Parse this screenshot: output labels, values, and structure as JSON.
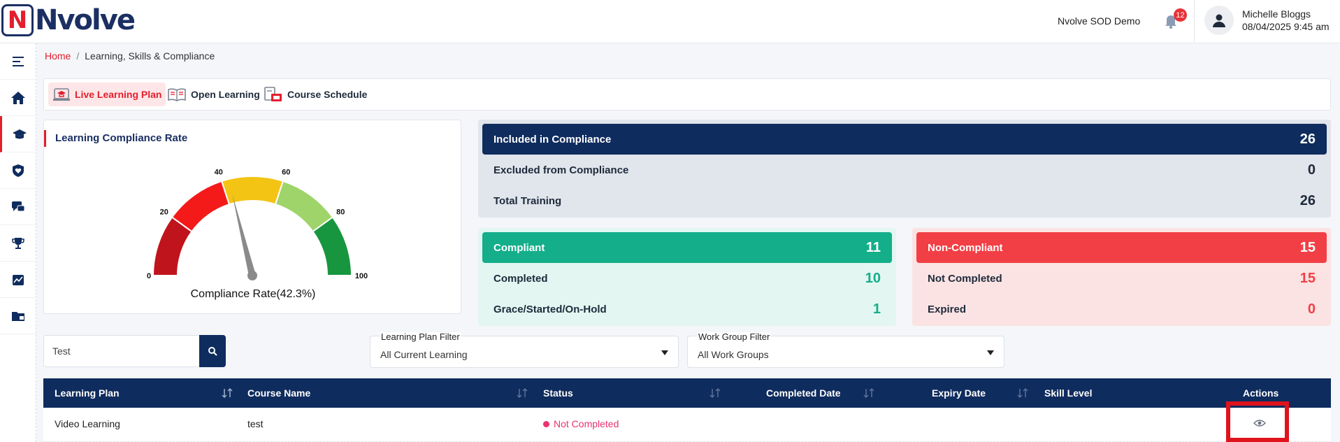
{
  "header": {
    "logo_letter": "N",
    "logo_text": "Nvolve",
    "org_name": "Nvolve SOD Demo",
    "notification_count": "12",
    "user_name": "Michelle Bloggs",
    "user_datetime": "08/04/2025 9:45 am"
  },
  "sidebar": {
    "items": [
      "menu-toggle-icon",
      "home-icon",
      "graduation-cap-icon",
      "shield-heart-icon",
      "chat-icon",
      "trophy-icon",
      "chart-icon",
      "folder-icon"
    ],
    "active_index": 2
  },
  "breadcrumb": {
    "home": "Home",
    "separator": "/",
    "current": "Learning, Skills & Compliance"
  },
  "tabs": [
    {
      "label": "Live Learning Plan",
      "active": true,
      "icon": "laptop-cap-icon"
    },
    {
      "label": "Open Learning",
      "active": false,
      "icon": "open-book-icon"
    },
    {
      "label": "Course Schedule",
      "active": false,
      "icon": "calendar-board-icon"
    }
  ],
  "gauge": {
    "title": "Learning Compliance Rate",
    "caption_label": "Compliance Rate",
    "caption_value": "(42.3%)",
    "value": 42.3,
    "min": 0,
    "max": 100,
    "ticks": [
      "0",
      "20",
      "40",
      "60",
      "80",
      "100"
    ],
    "band_colors": [
      "#c0141d",
      "#f41a1a",
      "#f3c414",
      "#9fd46a",
      "#17963f"
    ]
  },
  "summary": {
    "included_label": "Included in Compliance",
    "included_value": "26",
    "excluded_label": "Excluded from Compliance",
    "excluded_value": "0",
    "total_label": "Total Training",
    "total_value": "26"
  },
  "compliant": {
    "label": "Compliant",
    "value": "11",
    "completed_label": "Completed",
    "completed_value": "10",
    "grace_label": "Grace/Started/On-Hold",
    "grace_value": "1"
  },
  "non_compliant": {
    "label": "Non-Compliant",
    "value": "15",
    "not_completed_label": "Not Completed",
    "not_completed_value": "15",
    "expired_label": "Expired",
    "expired_value": "0"
  },
  "filters": {
    "search_value": "Test",
    "learning_plan_label": "Learning Plan Filter",
    "learning_plan_value": "All Current Learning",
    "work_group_label": "Work Group Filter",
    "work_group_value": "All Work Groups"
  },
  "table": {
    "columns": [
      "Learning Plan",
      "Course Name",
      "Status",
      "Completed Date",
      "Expiry Date",
      "Skill Level",
      "Actions"
    ],
    "rows": [
      {
        "learning_plan": "Video Learning",
        "course_name": "test",
        "status": "Not Completed",
        "completed_date": "",
        "expiry_date": "",
        "skill_level": ""
      }
    ]
  },
  "colors": {
    "brand_navy": "#0f2c5e",
    "brand_red": "#e31e2d",
    "compliant_green": "#14ae8a",
    "noncompliant_red": "#f23f45"
  }
}
